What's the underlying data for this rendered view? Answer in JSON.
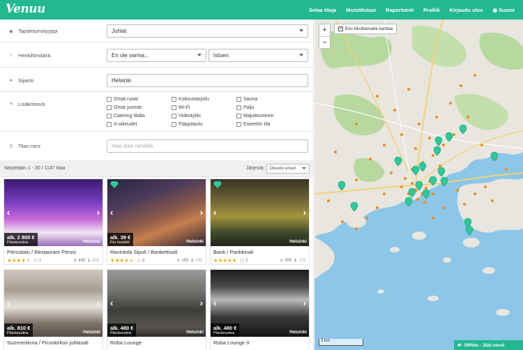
{
  "app": {
    "logo": "Venuu",
    "nav": [
      "Selaa tiloja",
      "Muistilistasi",
      "Raportointi",
      "Profiili",
      "Kirjaudu ulos",
      "Suomi"
    ]
  },
  "filters": {
    "event_type": {
      "label": "Tapahtumatyyppi",
      "value": "Juhlat"
    },
    "headcount": {
      "label": "Henkilömäärä",
      "value": "En ole varma...",
      "seating": "Istuen"
    },
    "location": {
      "label": "Sijainti",
      "value": "Helsinki"
    },
    "extras": {
      "label": "Lisäkriteerit",
      "options": [
        "Omat ruoat",
        "Kokoustarjoilu",
        "Sauna",
        "Omat juomat",
        "Wi-Fi",
        "Palju",
        "Catering tilalta",
        "Videotykki",
        "Majoittuminen",
        "A-oikeudet",
        "Fläppitaulu",
        "Esteetön tila"
      ]
    },
    "name": {
      "label": "Tilan nimi",
      "placeholder": "Hae tilan nimellä"
    }
  },
  "results": {
    "count": "Näytetään 1 - 30 / 1147 tilaa",
    "sort_label": "Järjestä:",
    "sort_value": "Osuvin ensin"
  },
  "venues": [
    {
      "price": "alk. 2 800 €",
      "unit": "Päivävuokra",
      "city": "Helsinki",
      "name": "Pörssitalo / Restaurant Pörssi",
      "rating": 4,
      "messages": "1",
      "capacity": "400",
      "standing": "400",
      "featured": false
    },
    {
      "price": "alk. 39 €",
      "unit": "Per henkilö",
      "city": "Helsinki",
      "name": "Ravintola Sipuli / Bankettisali",
      "rating": 4.5,
      "messages": "2",
      "capacity": "150",
      "standing": "200",
      "featured": true
    },
    {
      "price": "",
      "unit": "",
      "city": "Helsinki",
      "name": "Bank / Pankkisali",
      "rating": 5,
      "messages": "2",
      "capacity": "500",
      "standing": "725",
      "featured": true
    },
    {
      "price": "alk. 810 €",
      "unit": "Päivävuokra",
      "city": "Helsinki",
      "name": "Suomenlinna / Pirunkirkon juhlasali",
      "rating": 0,
      "messages": "",
      "capacity": "",
      "standing": "",
      "featured": false
    },
    {
      "price": "alk. 480 €",
      "unit": "Päivävuokra",
      "city": "Helsinki",
      "name": "Roba Lounge",
      "rating": 0,
      "messages": "",
      "capacity": "",
      "standing": "",
      "featured": false
    },
    {
      "price": "alk. 480 €",
      "unit": "Päivävuokra",
      "city": "Helsinki",
      "name": "Roba Lounge II",
      "rating": 0,
      "messages": "",
      "capacity": "",
      "standing": "",
      "featured": false
    }
  ],
  "map": {
    "zoom_in": "+",
    "zoom_out": "−",
    "search_on_move": "Etsi liikuttamalla karttaa",
    "scale": "3 km",
    "chat": "Offline - Jätä viesti"
  },
  "colors": {
    "brand": "#22b890",
    "star": "#f2a518",
    "pin": "#2ec89a",
    "cluster": "#f08a1c",
    "water": "#8cc6e8",
    "land": "#e8e6df"
  }
}
